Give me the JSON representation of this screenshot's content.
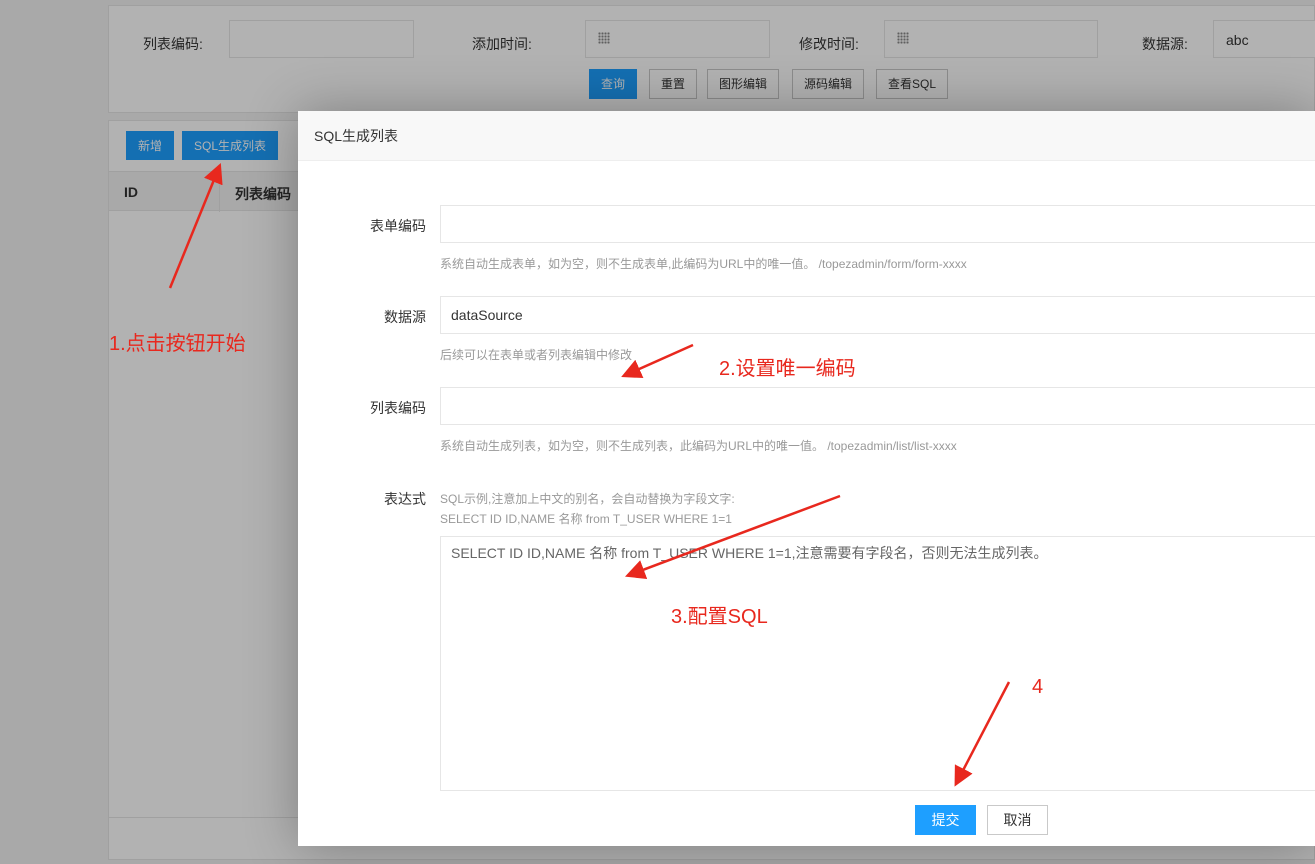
{
  "search": {
    "list_code_label": "列表编码:",
    "add_time_label": "添加时间:",
    "modify_time_label": "修改时间:",
    "datasource_label": "数据源:",
    "datasource_value": "abc",
    "buttons": {
      "query": "查询",
      "reset": "重置",
      "graphic_edit": "图形编辑",
      "source_edit": "源码编辑",
      "view_sql": "查看SQL"
    }
  },
  "list": {
    "buttons": {
      "add": "新增",
      "sql_generate": "SQL生成列表"
    },
    "columns": [
      "ID",
      "列表编码"
    ]
  },
  "modal": {
    "title": "SQL生成列表",
    "fields": {
      "form_code": {
        "label": "表单编码",
        "value": "",
        "hint": "系统自动生成表单，如为空，则不生成表单,此编码为URL中的唯一值。 /topezadmin/form/form-xxxx"
      },
      "datasource": {
        "label": "数据源",
        "value": "dataSource",
        "hint": "后续可以在表单或者列表编辑中修改"
      },
      "list_code": {
        "label": "列表编码",
        "value": "",
        "hint": "系统自动生成列表，如为空，则不生成列表，此编码为URL中的唯一值。 /topezadmin/list/list-xxxx"
      },
      "expression": {
        "label": "表达式",
        "hint_line1": "SQL示例,注意加上中文的别名，会自动替换为字段文字:",
        "hint_line2": "SELECT ID ID,NAME 名称 from T_USER WHERE 1=1",
        "placeholder": "SELECT ID ID,NAME 名称 from T_USER WHERE 1=1,注意需要有字段名，否则无法生成列表。"
      }
    },
    "buttons": {
      "submit": "提交",
      "cancel": "取消"
    }
  },
  "annotations": {
    "step1": "1.点击按钮开始",
    "step2": "2.设置唯一编码",
    "step3": "3.配置SQL",
    "step4": "4"
  },
  "colors": {
    "primary": "#1e9fff",
    "annotation": "#e8281e"
  }
}
